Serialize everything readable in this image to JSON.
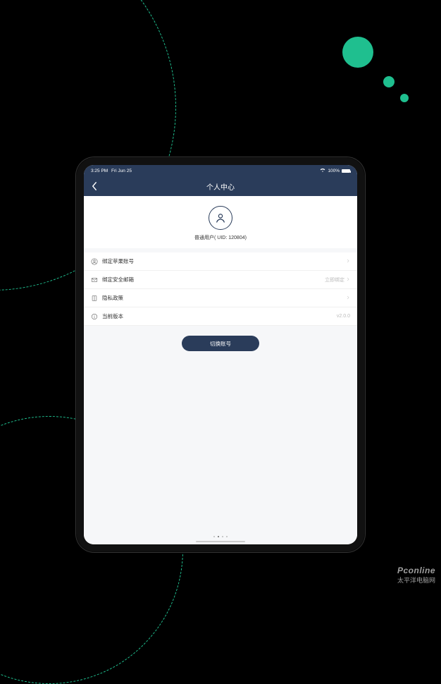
{
  "status": {
    "time": "3:25 PM",
    "date": "Fri Jun 25",
    "batt": "100%"
  },
  "nav": {
    "title": "个人中心"
  },
  "profile": {
    "userType": "普通用户",
    "uidLabel": "( UID: 120804)"
  },
  "rows": [
    {
      "icon": "user-circle-icon",
      "label": "绑定苹果账号",
      "tailText": "",
      "chevron": true
    },
    {
      "icon": "mail-icon",
      "label": "绑定安全邮箱",
      "tailText": "立即绑定",
      "chevron": true
    },
    {
      "icon": "doc-icon",
      "label": "隐私政策",
      "tailText": "",
      "chevron": true
    },
    {
      "icon": "info-icon",
      "label": "当前版本",
      "tailText": "v2.0.0",
      "chevron": false
    }
  ],
  "button": {
    "label": "切换账号"
  },
  "watermark": {
    "en": "Pconline",
    "cn": "太平洋电脑网"
  }
}
